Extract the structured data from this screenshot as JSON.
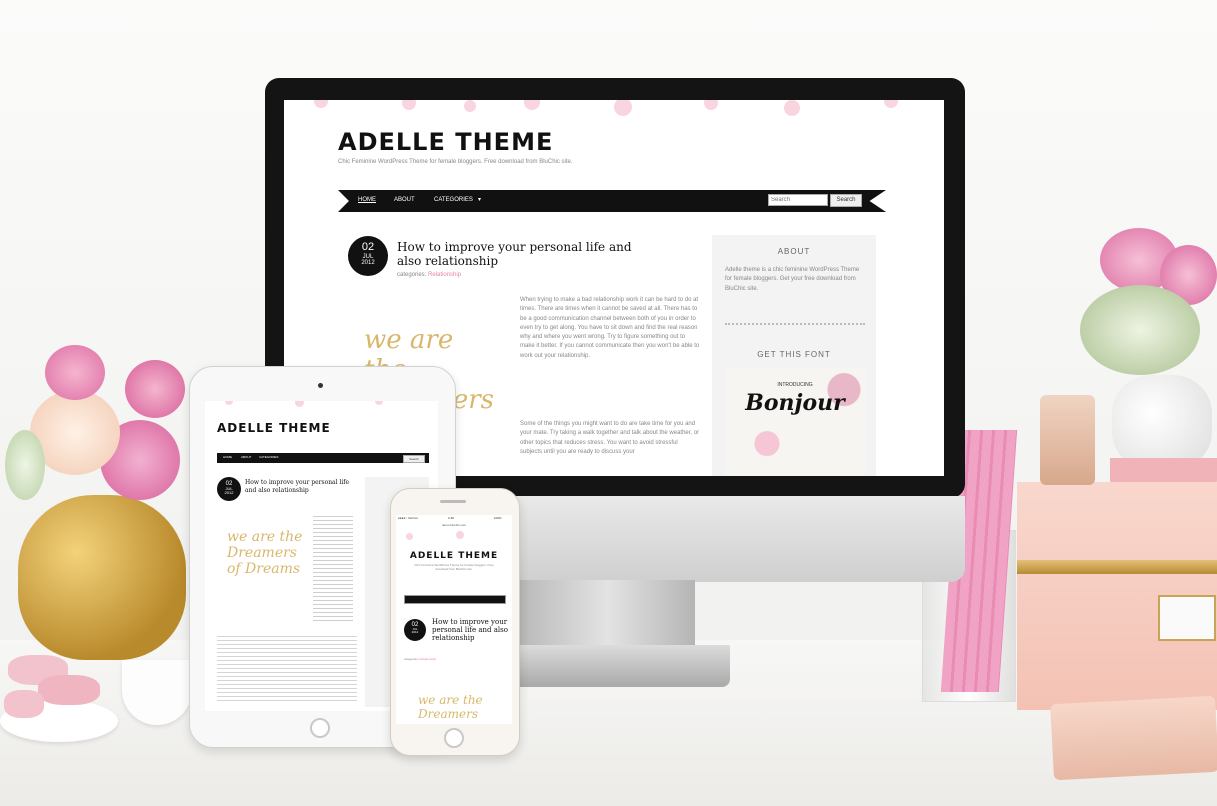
{
  "desktop": {
    "site_title": "ADELLE THEME",
    "tagline": "Chic Feminine WordPress Theme for female bloggers. Free download from BluChic site.",
    "nav": {
      "items": [
        "HOME",
        "ABOUT",
        "CATEGORIES"
      ],
      "categories_caret": "▾",
      "search_placeholder": "Search",
      "search_button": "Search"
    },
    "post": {
      "day": "02",
      "month": "JUL",
      "year": "2012",
      "title": "How to improve your personal life and also relationship",
      "categories_label": "categories:",
      "category": "Relationship",
      "image_text": "we are the Dreamers",
      "paragraph1": "When trying to make a bad relationship work it can be hard to do at times. There are times when it cannot be saved at all. There has to be a good communication channel between both of you in order to even try to get along. You have to sit down and find the real reason why and where you went wrong. Try to figure something out to make it better. If you cannot communicate then you won't be able to work out your relationship.",
      "paragraph2": "Some of the things you might want to do are take time for you and your mate. Try taking a walk together and talk about the weather, or other topics that reduces stress. You want to avoid stressful subjects until you are ready to discuss your"
    },
    "sidebar": {
      "about_title": "ABOUT",
      "about_text": "Adelle theme is a chic feminine WordPress Theme for female bloggers. Get your free download from BluChic site.",
      "font_title": "GET THIS FONT",
      "font_image_text": "Bonjour",
      "font_image_caption": "INTRODUCING"
    }
  },
  "tablet": {
    "site_title": "ADELLE THEME",
    "nav_items": [
      "HOME",
      "ABOUT",
      "CATEGORIES"
    ],
    "search_button": "Search",
    "post_day": "02",
    "post_month": "JUL",
    "post_year": "2012",
    "post_title": "How to improve your personal life and also relationship",
    "image_text": "we are the Dreamers of Dreams"
  },
  "phone": {
    "status_carrier": "●●●●○ Verizon",
    "status_time": "2:48",
    "status_battery": "100%",
    "url": "demo.bluchic.com",
    "site_title": "ADELLE THEME",
    "tagline": "Chic Feminine WordPress Theme for female bloggers. Free download from BluChic site.",
    "post_day": "02",
    "post_month": "JUL",
    "post_year": "2012",
    "post_title": "How to improve your personal life and also relationship",
    "categories_label": "categories:",
    "category": "Relationship",
    "image_text": "we are the Dreamers"
  },
  "colors": {
    "accent_pink": "#e8869f",
    "nav_black": "#111111",
    "gold": "#d8b76a"
  }
}
